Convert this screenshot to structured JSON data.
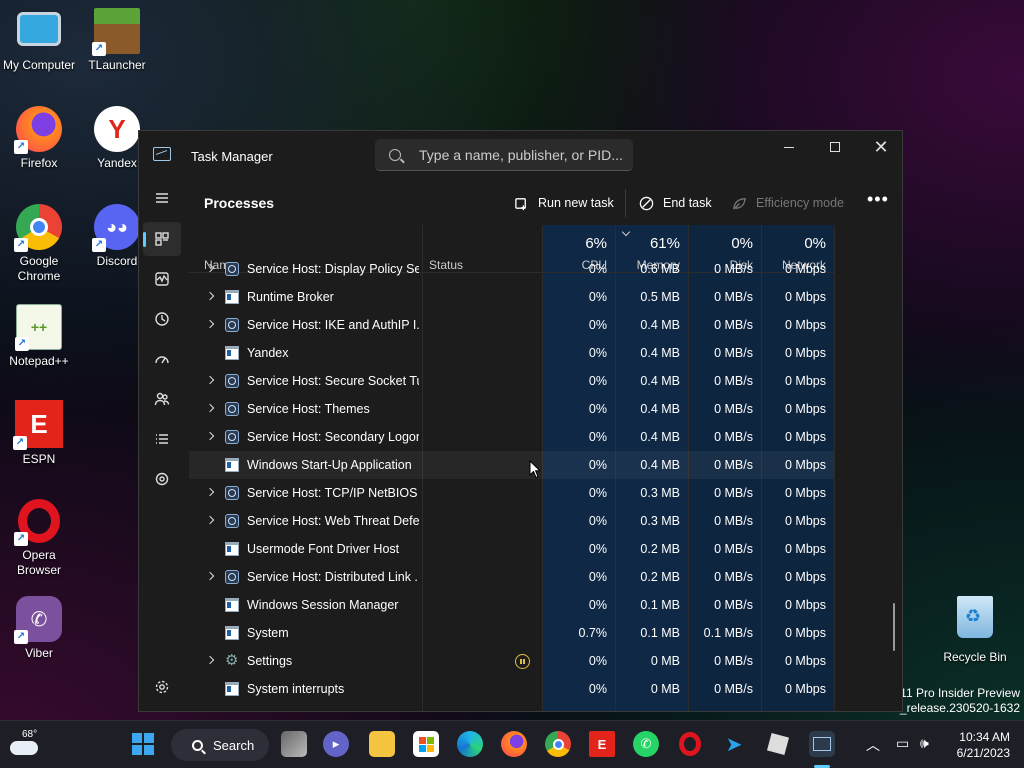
{
  "desktop": {
    "icons_left": [
      {
        "label": "My Computer"
      },
      {
        "label": "Firefox"
      },
      {
        "label": "Google Chrome"
      },
      {
        "label": "Notepad++"
      },
      {
        "label": "ESPN"
      },
      {
        "label": "Opera Browser"
      },
      {
        "label": "Viber"
      }
    ],
    "icons_right": [
      {
        "label": "TLauncher"
      },
      {
        "label": "Yandex"
      },
      {
        "label": "Discord"
      }
    ],
    "recycle_bin": "Recycle Bin",
    "watermark": [
      "11 Pro Insider Preview",
      "n_release.230520-1632"
    ]
  },
  "window": {
    "title": "Task Manager",
    "search_placeholder": "Type a name, publisher, or PID...",
    "page_title": "Processes",
    "toolbar": {
      "run_new_task": "Run new task",
      "end_task": "End task",
      "efficiency_mode": "Efficiency mode",
      "more": "•••"
    },
    "columns": {
      "name": "Name",
      "status": "Status",
      "cpu": {
        "pct": "6%",
        "label": "CPU"
      },
      "memory": {
        "pct": "61%",
        "label": "Memory"
      },
      "disk": {
        "pct": "0%",
        "label": "Disk"
      },
      "network": {
        "pct": "0%",
        "label": "Network"
      }
    },
    "processes": [
      {
        "name": "Service Host: Display Policy Se...",
        "expand": true,
        "icon": "service-icon",
        "cpu": "0%",
        "mem": "0.6 MB",
        "disk": "0 MB/s",
        "net": "0 Mbps"
      },
      {
        "name": "Runtime Broker",
        "expand": true,
        "icon": "app-window-icon",
        "cpu": "0%",
        "mem": "0.5 MB",
        "disk": "0 MB/s",
        "net": "0 Mbps"
      },
      {
        "name": "Service Host: IKE and AuthIP I...",
        "expand": true,
        "icon": "service-icon",
        "cpu": "0%",
        "mem": "0.4 MB",
        "disk": "0 MB/s",
        "net": "0 Mbps"
      },
      {
        "name": "Yandex",
        "expand": false,
        "icon": "app-window-icon",
        "cpu": "0%",
        "mem": "0.4 MB",
        "disk": "0 MB/s",
        "net": "0 Mbps"
      },
      {
        "name": "Service Host: Secure Socket Tu...",
        "expand": true,
        "icon": "service-icon",
        "cpu": "0%",
        "mem": "0.4 MB",
        "disk": "0 MB/s",
        "net": "0 Mbps"
      },
      {
        "name": "Service Host: Themes",
        "expand": true,
        "icon": "service-icon",
        "cpu": "0%",
        "mem": "0.4 MB",
        "disk": "0 MB/s",
        "net": "0 Mbps"
      },
      {
        "name": "Service Host: Secondary Logon",
        "expand": true,
        "icon": "service-icon",
        "cpu": "0%",
        "mem": "0.4 MB",
        "disk": "0 MB/s",
        "net": "0 Mbps"
      },
      {
        "name": "Windows Start-Up Application",
        "expand": false,
        "icon": "app-window-icon",
        "cpu": "0%",
        "mem": "0.4 MB",
        "disk": "0 MB/s",
        "net": "0 Mbps",
        "hover": true
      },
      {
        "name": "Service Host: TCP/IP NetBIOS ...",
        "expand": true,
        "icon": "service-icon",
        "cpu": "0%",
        "mem": "0.3 MB",
        "disk": "0 MB/s",
        "net": "0 Mbps"
      },
      {
        "name": "Service Host: Web Threat Defe...",
        "expand": true,
        "icon": "service-icon",
        "cpu": "0%",
        "mem": "0.3 MB",
        "disk": "0 MB/s",
        "net": "0 Mbps"
      },
      {
        "name": "Usermode Font Driver Host",
        "expand": false,
        "icon": "app-window-icon",
        "cpu": "0%",
        "mem": "0.2 MB",
        "disk": "0 MB/s",
        "net": "0 Mbps"
      },
      {
        "name": "Service Host: Distributed Link ...",
        "expand": true,
        "icon": "service-icon",
        "cpu": "0%",
        "mem": "0.2 MB",
        "disk": "0 MB/s",
        "net": "0 Mbps"
      },
      {
        "name": "Windows Session Manager",
        "expand": false,
        "icon": "app-window-icon",
        "cpu": "0%",
        "mem": "0.1 MB",
        "disk": "0 MB/s",
        "net": "0 Mbps"
      },
      {
        "name": "System",
        "expand": false,
        "icon": "app-window-icon",
        "cpu": "0.7%",
        "mem": "0.1 MB",
        "disk": "0.1 MB/s",
        "net": "0 Mbps"
      },
      {
        "name": "Settings",
        "expand": true,
        "icon": "gear-icon",
        "cpu": "0%",
        "mem": "0 MB",
        "disk": "0 MB/s",
        "net": "0 Mbps",
        "suspended": true
      },
      {
        "name": "System interrupts",
        "expand": false,
        "icon": "app-window-icon",
        "cpu": "0%",
        "mem": "0 MB",
        "disk": "0 MB/s",
        "net": "0 Mbps"
      }
    ]
  },
  "taskbar": {
    "temperature": "68°",
    "search_label": "Search",
    "time": "10:34 AM",
    "date": "6/21/2023"
  }
}
